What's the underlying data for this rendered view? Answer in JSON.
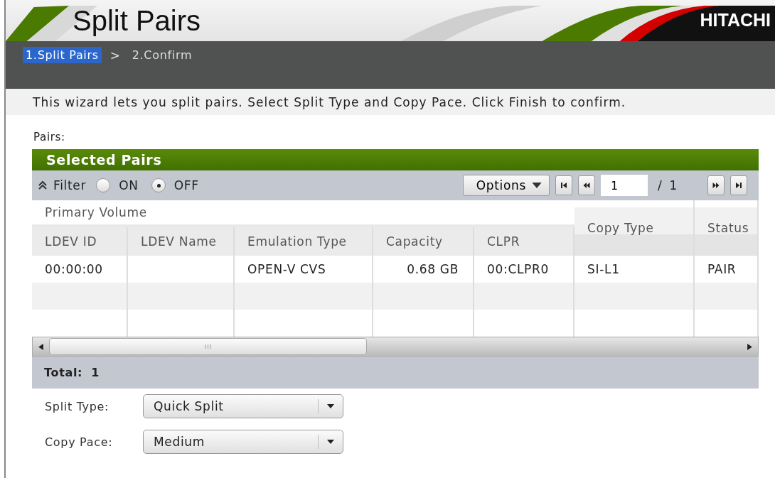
{
  "header": {
    "title": "Split Pairs",
    "logo": "HITACHI"
  },
  "steps": [
    {
      "label": "1.Split Pairs",
      "selected": true
    },
    {
      "label": "2.Confirm",
      "selected": false
    }
  ],
  "step_separator": ">",
  "description": "This wizard lets you split pairs. Select Split Type and Copy Pace. Click Finish to confirm.",
  "pairs_label": "Pairs:",
  "panel": {
    "title": "Selected Pairs",
    "filter": {
      "label": "Filter",
      "options": [
        {
          "label": "ON",
          "selected": false
        },
        {
          "label": "OFF",
          "selected": true
        }
      ]
    },
    "options_button": "Options",
    "pager": {
      "page": "1",
      "separator": "/",
      "total": "1"
    },
    "table": {
      "column_groups": [
        {
          "label": "Primary Volume",
          "columns": [
            {
              "label": "LDEV ID",
              "kind": "text"
            },
            {
              "label": "LDEV Name",
              "kind": "text"
            },
            {
              "label": "Emulation Type",
              "kind": "text"
            },
            {
              "label": "Capacity",
              "kind": "number"
            },
            {
              "label": "CLPR",
              "kind": "text"
            }
          ]
        },
        {
          "columns": [
            {
              "label": "Copy Type",
              "kind": "text"
            }
          ]
        },
        {
          "columns": [
            {
              "label": "Status",
              "kind": "text"
            }
          ]
        }
      ],
      "rows": [
        [
          "00:00:00",
          "",
          "OPEN-V CVS",
          "0.68 GB",
          "00:CLPR0",
          "SI-L1",
          "PAIR"
        ]
      ]
    },
    "total_label": "Total:",
    "total": "1"
  },
  "form": [
    {
      "label": "Split Type:",
      "value": "Quick Split"
    },
    {
      "label": "Copy Pace:",
      "value": "Medium"
    }
  ]
}
